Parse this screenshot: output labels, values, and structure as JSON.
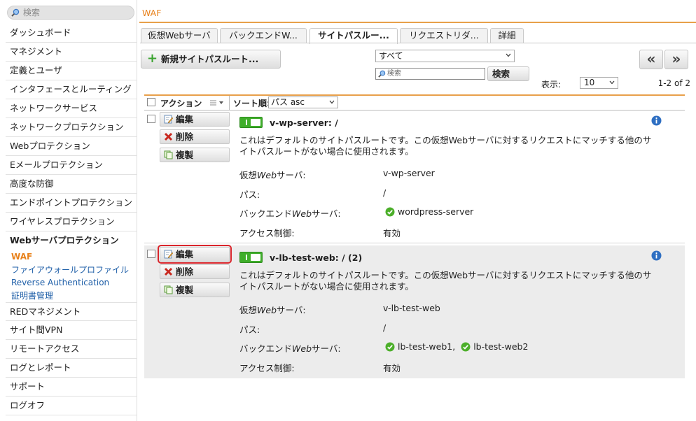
{
  "sidebar": {
    "search_placeholder": "検索",
    "items": [
      {
        "label": "ダッシュボード"
      },
      {
        "label": "マネジメント"
      },
      {
        "label": "定義とユーザ"
      },
      {
        "label": "インタフェースとルーティング"
      },
      {
        "label": "ネットワークサービス"
      },
      {
        "label": "ネットワークプロテクション"
      },
      {
        "label": "Webプロテクション"
      },
      {
        "label": "Eメールプロテクション"
      },
      {
        "label": "高度な防御"
      },
      {
        "label": "エンドポイントプロテクション"
      },
      {
        "label": "ワイヤレスプロテクション"
      },
      {
        "label": "Webサーバプロテクション"
      }
    ],
    "subitems": [
      {
        "label": "WAF"
      },
      {
        "label": "ファイアウォールプロファイル"
      },
      {
        "label": "Reverse Authentication"
      },
      {
        "label": "証明書管理"
      }
    ],
    "items_after": [
      {
        "label": "REDマネジメント"
      },
      {
        "label": "サイト間VPN"
      },
      {
        "label": "リモートアクセス"
      },
      {
        "label": "ログとレポート"
      },
      {
        "label": "サポート"
      },
      {
        "label": "ログオフ"
      }
    ]
  },
  "header": {
    "title": "WAF"
  },
  "tabs": [
    {
      "label": "仮想Webサーバ"
    },
    {
      "label": "バックエンドW..."
    },
    {
      "label": "サイトパスルー..."
    },
    {
      "label": "リクエストリダ..."
    },
    {
      "label": "詳細"
    }
  ],
  "toolbar": {
    "new_button": "新規サイトパスルート...",
    "filter_value": "すべて",
    "search_placeholder": "検索",
    "search_button": "検索",
    "nav_first": "«",
    "nav_prev": "»",
    "display_label": "表示:",
    "per_page": "10",
    "range": "1-2 of 2"
  },
  "table": {
    "action_header": "アクション",
    "sort_label": "ソート順:",
    "sort_value": "パス asc"
  },
  "actions": {
    "edit": "編集",
    "delete": "削除",
    "clone": "複製"
  },
  "rows": [
    {
      "title": "v-wp-server: /",
      "description": "これはデフォルトのサイトパスルートです。この仮想Webサーバに対するリクエストにマッチする他のサイトパスルートがない場合に使用されます。",
      "labels": {
        "vserver_a": "仮想",
        "vserver_b": "Web",
        "vserver_c": "サーバ:",
        "path": "パス:",
        "backend_a": "バックエンド",
        "backend_b": "Web",
        "backend_c": "サーバ:",
        "access": "アクセス制御:"
      },
      "vserver": "v-wp-server",
      "path": "/",
      "backends": [
        "wordpress-server"
      ],
      "access": "有効"
    },
    {
      "title": "v-lb-test-web: / (2)",
      "description": "これはデフォルトのサイトパスルートです。この仮想Webサーバに対するリクエストにマッチする他のサイトパスルートがない場合に使用されます。",
      "labels": {
        "vserver_a": "仮想",
        "vserver_b": "Web",
        "vserver_c": "サーバ:",
        "path": "パス:",
        "backend_a": "バックエンド",
        "backend_b": "Web",
        "backend_c": "サーバ:",
        "access": "アクセス制御:"
      },
      "vserver": "v-lb-test-web",
      "path": "/",
      "backends": [
        "lb-test-web1,",
        "lb-test-web2"
      ],
      "access": "有効"
    }
  ],
  "colors": {
    "accent": "#e8821c",
    "toggle_on": "#3fae2a",
    "highlight": "#d9262c",
    "link": "#1f5fa8"
  }
}
